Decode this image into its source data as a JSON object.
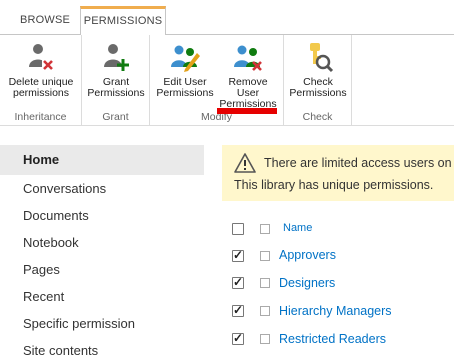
{
  "ribbon": {
    "tabs": [
      "BROWSE",
      "PERMISSIONS"
    ],
    "groups": [
      "Inheritance",
      "Grant",
      "Modify",
      "Check"
    ],
    "buttons": {
      "delete_unique": [
        "Delete unique",
        "permissions"
      ],
      "grant": [
        "Grant",
        "Permissions"
      ],
      "edit_user": [
        "Edit User",
        "Permissions"
      ],
      "remove_user": [
        "Remove User",
        "Permissions"
      ],
      "check": [
        "Check",
        "Permissions"
      ]
    }
  },
  "nav": {
    "items": [
      "Home",
      "Conversations",
      "Documents",
      "Notebook",
      "Pages",
      "Recent",
      "Specific permission",
      "Site contents"
    ]
  },
  "notice": {
    "line1": "There are limited access users on",
    "line2": "This library has unique permissions."
  },
  "list": {
    "column_name": "Name",
    "rows": [
      "Approvers",
      "Designers",
      "Hierarchy Managers",
      "Restricted Readers"
    ]
  },
  "colors": {
    "accent_tab": "#f0ad4e",
    "link": "#0072c6",
    "notice_bg": "#fff7cc",
    "highlight": "#e60000"
  }
}
